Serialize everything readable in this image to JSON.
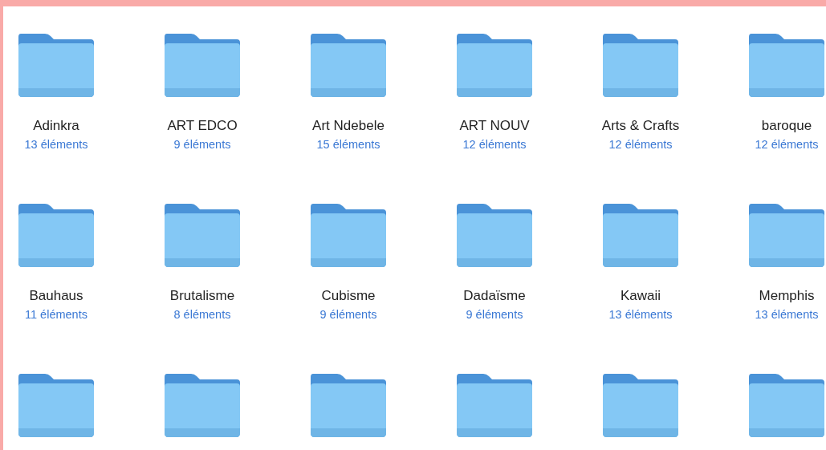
{
  "folders": [
    {
      "kind": "folder",
      "name": "Adinkra",
      "count": "13 éléments"
    },
    {
      "kind": "folder",
      "name": "ART EDCO",
      "count": "9 éléments"
    },
    {
      "kind": "folder",
      "name": "Art Ndebele",
      "count": "15 éléments"
    },
    {
      "kind": "folder",
      "name": "ART NOUV",
      "count": "12 éléments"
    },
    {
      "kind": "folder",
      "name": "Arts & Crafts",
      "count": "12 éléments"
    },
    {
      "kind": "folder",
      "name": "baroque",
      "count": "12 éléments"
    },
    {
      "kind": "folder",
      "name": "Bauhaus",
      "count": "11 éléments"
    },
    {
      "kind": "folder",
      "name": "Brutalisme",
      "count": "8 éléments"
    },
    {
      "kind": "folder",
      "name": "Cubisme",
      "count": "9 éléments"
    },
    {
      "kind": "folder",
      "name": "Dadaïsme",
      "count": "9 éléments"
    },
    {
      "kind": "folder",
      "name": "Kawaii",
      "count": "13 éléments"
    },
    {
      "kind": "folder",
      "name": "Memphis",
      "count": "13 éléments"
    },
    {
      "kind": "folder"
    },
    {
      "kind": "folder"
    },
    {
      "kind": "folder"
    },
    {
      "kind": "folder"
    },
    {
      "kind": "folder"
    },
    {
      "kind": "folder"
    }
  ]
}
